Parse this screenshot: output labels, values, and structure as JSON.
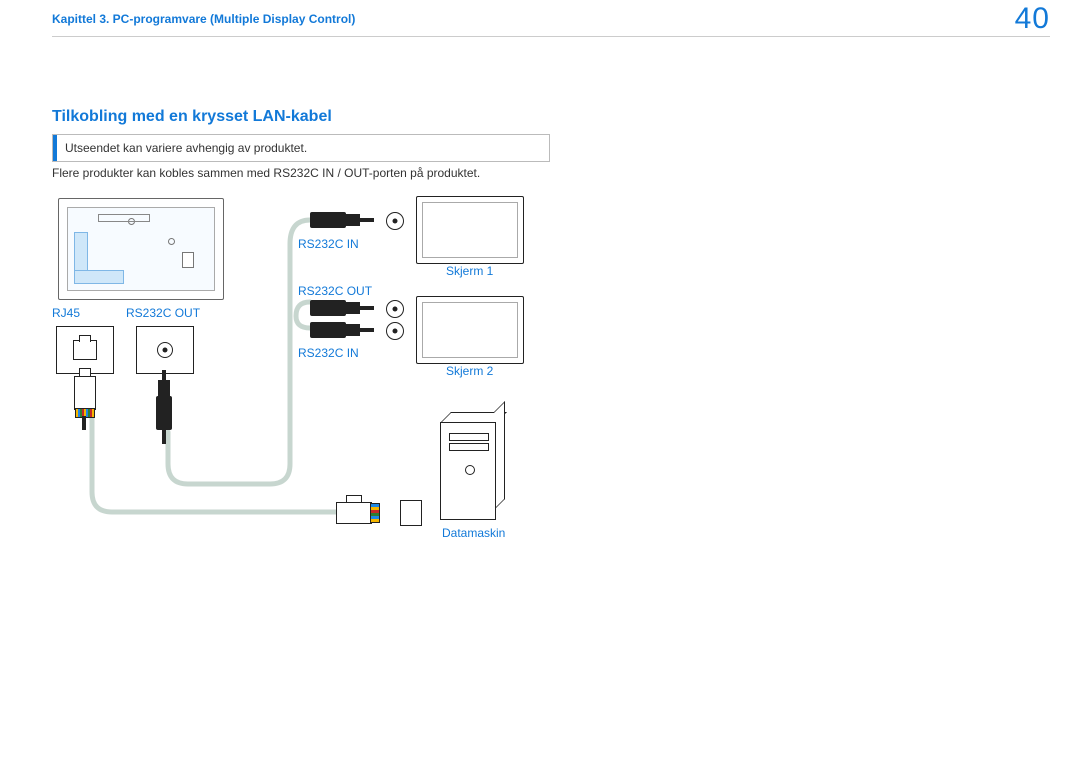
{
  "header": {
    "chapter": "Kapittel 3. PC-programvare (Multiple Display Control)",
    "page_number": "40"
  },
  "section": {
    "title": "Tilkobling med en krysset LAN-kabel",
    "note": "Utseendet kan variere avhengig av produktet.",
    "body": "Flere produkter kan kobles sammen med RS232C IN / OUT-porten på produktet."
  },
  "diagram": {
    "labels": {
      "rj45": "RJ45",
      "rs232c_out_left": "RS232C OUT",
      "rs232c_in_upper": "RS232C IN",
      "rs232c_out_mid": "RS232C OUT",
      "rs232c_in_lower": "RS232C IN",
      "monitor1": "Skjerm 1",
      "monitor2": "Skjerm 2",
      "computer": "Datamaskin"
    }
  }
}
